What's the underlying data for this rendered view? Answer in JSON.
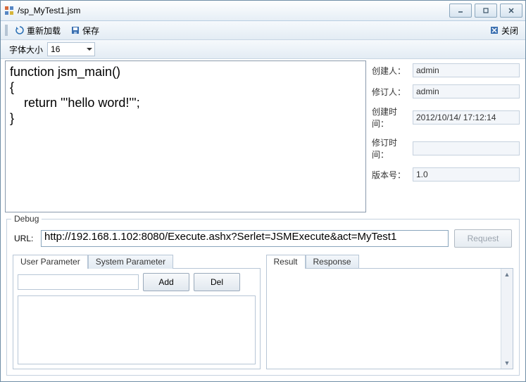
{
  "window": {
    "title": "/sp_MyTest1.jsm"
  },
  "toolbar": {
    "reload_label": "重新加载",
    "save_label": "保存",
    "close_label": "关闭"
  },
  "fontbar": {
    "label": "字体大小",
    "value": "16"
  },
  "code": "function jsm_main()\n{\n    return '''hello word!''';\n}",
  "meta": {
    "creator_label": "创建人：",
    "creator": "admin",
    "reviser_label": "修订人：",
    "reviser": "admin",
    "ctime_label": "创建时间：",
    "ctime": "2012/10/14/ 17:12:14",
    "mtime_label": "修订时间：",
    "mtime": "",
    "version_label": "版本号：",
    "version": "1.0"
  },
  "debug": {
    "legend": "Debug",
    "url_label": "URL:",
    "url": "http://192.168.1.102:8080/Execute.ashx?Serlet=JSMExecute&act=MyTest1",
    "request_label": "Request",
    "tab_user": "User Parameter",
    "tab_system": "System Parameter",
    "add_label": "Add",
    "del_label": "Del",
    "tab_result": "Result",
    "tab_response": "Response"
  }
}
